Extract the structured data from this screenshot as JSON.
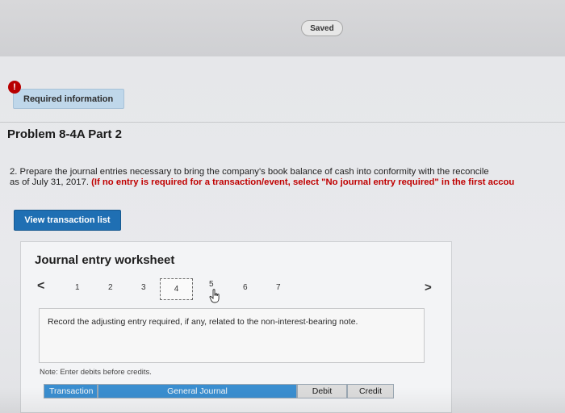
{
  "header": {
    "saved_status": "Saved"
  },
  "required_info": {
    "badge": "!",
    "label": "Required information"
  },
  "problem": {
    "title": "Problem 8-4A Part 2",
    "line1": "2. Prepare the journal entries necessary to bring the company's book balance of cash into conformity with the reconcile",
    "line2_plain": "as of July 31, 2017. ",
    "line2_red": "(If no entry is required for a transaction/event, select \"No journal entry required\" in the first accou"
  },
  "buttons": {
    "view_transaction_list": "View transaction list"
  },
  "worksheet": {
    "title": "Journal entry worksheet",
    "prev_arrow": "<",
    "next_arrow": ">",
    "pages": [
      "1",
      "2",
      "3",
      "4",
      "5",
      "6",
      "7"
    ],
    "active_page": "4",
    "instruction": "Record the adjusting entry required, if any, related to the non-interest-bearing note.",
    "note": "Note: Enter debits before credits.",
    "table_headers": {
      "transaction": "Transaction",
      "general_journal": "General Journal",
      "debit": "Debit",
      "credit": "Credit"
    }
  },
  "colors": {
    "primary_blue": "#1f6fb3",
    "table_header_blue": "#3a8ed0",
    "error_red": "#c00000",
    "badge_red": "#b80000",
    "tab_blue": "#bfd7ea"
  },
  "icons": {
    "cursor": "hand-pointer-icon"
  }
}
